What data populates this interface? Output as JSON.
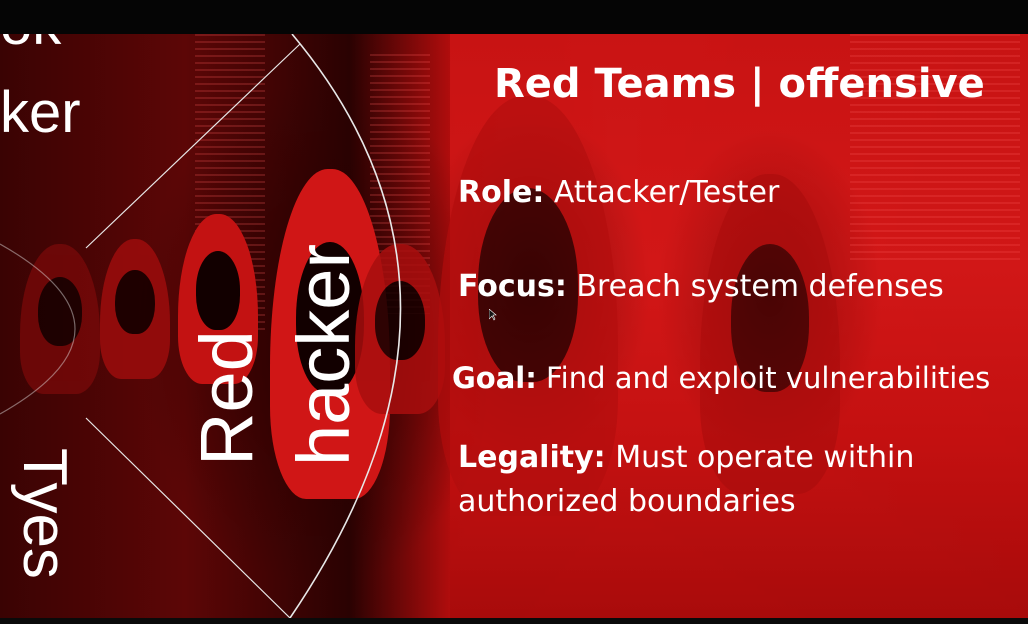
{
  "slide": {
    "left_fragment_top": "ok",
    "left_fragment_word": "ker",
    "left_vertical_word": "Tyes",
    "vertical_red": "Red",
    "vertical_hacker": "hacker",
    "title": "Red Teams | offensive",
    "bullets": [
      {
        "label": "Role:",
        "text": " Attacker/Tester"
      },
      {
        "label": "Focus:",
        "text": " Breach system defenses"
      },
      {
        "label": "Goal:",
        "text": " Find and exploit vulnerabilities"
      },
      {
        "label": "Legality:",
        "text": " Must operate within",
        "text_line2": "authorized boundaries"
      }
    ]
  },
  "colors": {
    "accent_red": "#d31818",
    "dark_red": "#3a0303",
    "text": "#ffffff"
  }
}
